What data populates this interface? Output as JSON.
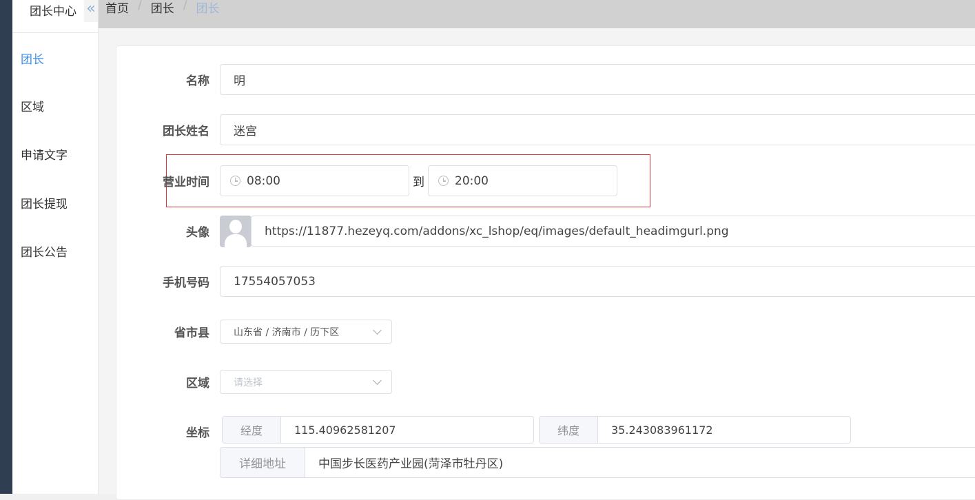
{
  "sidebar": {
    "title": "团长中心",
    "collapse_icon": "«",
    "items": [
      {
        "label": "团长",
        "active": true
      },
      {
        "label": "区域",
        "active": false
      },
      {
        "label": "申请文字",
        "active": false
      },
      {
        "label": "团长提现",
        "active": false
      },
      {
        "label": "团长公告",
        "active": false
      }
    ]
  },
  "breadcrumb": [
    "首页",
    "团长",
    "团长"
  ],
  "breadcrumb_sep": "/",
  "form": {
    "name": {
      "label": "名称",
      "value": "明"
    },
    "leader_name": {
      "label": "团长姓名",
      "value": "迷宫"
    },
    "hours": {
      "label": "营业时间",
      "start": "08:00",
      "to": "到",
      "end": "20:00"
    },
    "avatar": {
      "label": "头像",
      "value": "https://11877.hezeyq.com/addons/xc_lshop/eq/images/default_headimgurl.png"
    },
    "phone": {
      "label": "手机号码",
      "value": "17554057053"
    },
    "region_select": {
      "label": "省市县",
      "value": "山东省 / 济南市 / 历下区"
    },
    "area_select": {
      "label": "区域",
      "placeholder": "请选择"
    },
    "coords": {
      "label": "坐标",
      "lng_label": "经度",
      "lng": "115.40962581207",
      "lat_label": "纬度",
      "lat": "35.243083961172",
      "addr_label": "详细地址",
      "addr": "中国步长医药产业园(菏泽市牡丹区)"
    }
  },
  "colors": {
    "accent": "#3a8ee6",
    "highlight_border": "#d9363e",
    "dark_strip": "#2f3e50"
  }
}
